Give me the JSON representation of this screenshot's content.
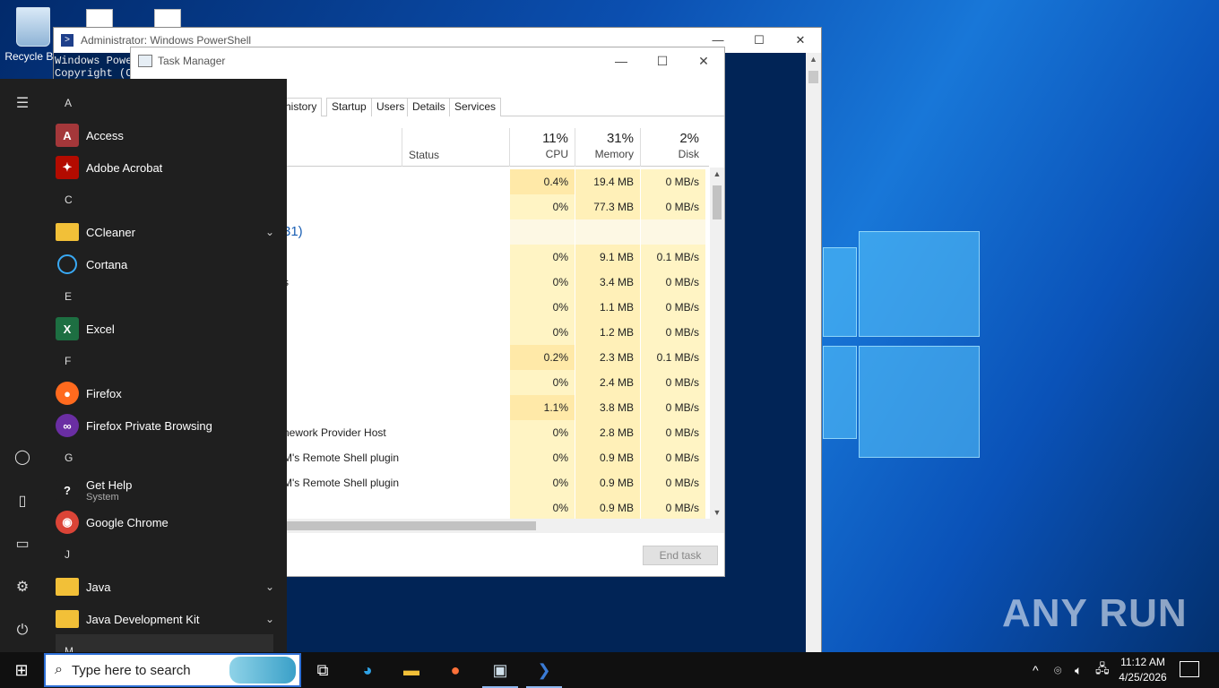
{
  "desktop": {
    "recycle_bin_label": "Recycle Bin",
    "watermark": "ANY RUN"
  },
  "powershell": {
    "title": "Administrator: Windows PowerShell",
    "lines": [
      "Windows Powe",
      "Copyright (C"
    ]
  },
  "task_manager": {
    "title": "Task Manager",
    "tabs": [
      "history",
      "Startup",
      "Users",
      "Details",
      "Services"
    ],
    "columns": {
      "status": "Status",
      "cpu": {
        "pct": "11%",
        "label": "CPU"
      },
      "memory": {
        "pct": "31%",
        "label": "Memory"
      },
      "disk": {
        "pct": "2%",
        "label": "Disk"
      }
    },
    "rows": [
      {
        "name": "",
        "cpu": "0.4%",
        "mem": "19.4 MB",
        "disk": "0 MB/s"
      },
      {
        "name": ")",
        "cpu": "0%",
        "mem": "77.3 MB",
        "disk": "0 MB/s"
      },
      {
        "name": "31)",
        "cpu": "",
        "mem": "",
        "disk": "",
        "group": true
      },
      {
        "name": "",
        "cpu": "0%",
        "mem": "9.1 MB",
        "disk": "0.1 MB/s"
      },
      {
        "name": "s",
        "cpu": "0%",
        "mem": "3.4 MB",
        "disk": "0 MB/s"
      },
      {
        "name": "",
        "cpu": "0%",
        "mem": "1.1 MB",
        "disk": "0 MB/s"
      },
      {
        "name": "",
        "cpu": "0%",
        "mem": "1.2 MB",
        "disk": "0 MB/s"
      },
      {
        "name": "",
        "cpu": "0.2%",
        "mem": "2.3 MB",
        "disk": "0.1 MB/s"
      },
      {
        "name": "",
        "cpu": "0%",
        "mem": "2.4 MB",
        "disk": "0 MB/s"
      },
      {
        "name": "",
        "cpu": "1.1%",
        "mem": "3.8 MB",
        "disk": "0 MB/s"
      },
      {
        "name": "nework Provider Host",
        "cpu": "0%",
        "mem": "2.8 MB",
        "disk": "0 MB/s"
      },
      {
        "name": "M's Remote Shell plugin",
        "cpu": "0%",
        "mem": "0.9 MB",
        "disk": "0 MB/s"
      },
      {
        "name": "M's Remote Shell plugin",
        "cpu": "0%",
        "mem": "0.9 MB",
        "disk": "0 MB/s"
      },
      {
        "name": "",
        "cpu": "0%",
        "mem": "0.9 MB",
        "disk": "0 MB/s"
      }
    ],
    "end_task": "End task"
  },
  "start_menu": {
    "items": [
      {
        "type": "letter",
        "text": "A"
      },
      {
        "type": "app",
        "text": "Access",
        "icon": "access-icon",
        "color": "#a4373a",
        "glyph": "A"
      },
      {
        "type": "app",
        "text": "Adobe Acrobat",
        "icon": "acrobat-icon",
        "color": "#b30b00",
        "glyph": "✦"
      },
      {
        "type": "letter",
        "text": "C"
      },
      {
        "type": "app",
        "text": "CCleaner",
        "icon": "folder-icon",
        "folder": true,
        "chevron": true
      },
      {
        "type": "app",
        "text": "Cortana",
        "icon": "cortana-icon",
        "color": "ring",
        "glyph": ""
      },
      {
        "type": "letter",
        "text": "E"
      },
      {
        "type": "app",
        "text": "Excel",
        "icon": "excel-icon",
        "color": "#1d6f42",
        "glyph": "X"
      },
      {
        "type": "letter",
        "text": "F"
      },
      {
        "type": "app",
        "text": "Firefox",
        "icon": "firefox-icon",
        "color": "#ff6a1e",
        "glyph": "●",
        "round": true
      },
      {
        "type": "app",
        "text": "Firefox Private Browsing",
        "icon": "firefox-private-icon",
        "color": "#6a2ea3",
        "glyph": "∞",
        "round": true
      },
      {
        "type": "letter",
        "text": "G"
      },
      {
        "type": "app",
        "text": "Get Help",
        "sub": "System",
        "icon": "get-help-icon",
        "color": "#1f1f1f",
        "glyph": "?"
      },
      {
        "type": "app",
        "text": "Google Chrome",
        "icon": "chrome-icon",
        "color": "#db4437",
        "glyph": "◉",
        "round": true
      },
      {
        "type": "letter",
        "text": "J"
      },
      {
        "type": "app",
        "text": "Java",
        "icon": "folder-icon",
        "folder": true,
        "chevron": true
      },
      {
        "type": "app",
        "text": "Java Development Kit",
        "icon": "folder-icon",
        "folder": true,
        "chevron": true
      },
      {
        "type": "letter",
        "text": "M"
      }
    ]
  },
  "taskbar": {
    "search_placeholder": "Type here to search",
    "time": "11:12 AM",
    "date": "4/25/2026"
  }
}
